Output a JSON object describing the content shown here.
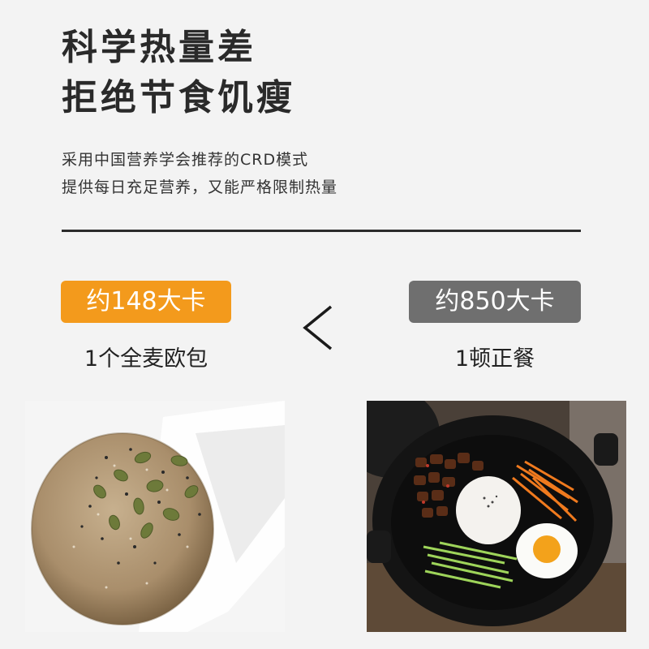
{
  "headline": {
    "line1": "科学热量差",
    "line2": "拒绝节食饥瘦"
  },
  "subtitle": {
    "line1": "采用中国营养学会推荐的CRD模式",
    "line2": "提供每日充足营养，又能严格限制热量"
  },
  "comparison": {
    "left": {
      "badge": "约148大卡",
      "caption": "1个全麦欧包",
      "badge_color": "#f39a1c"
    },
    "symbol": "<",
    "right": {
      "badge": "约850大卡",
      "caption": "1顿正餐",
      "badge_color": "#6f6f6f"
    }
  }
}
